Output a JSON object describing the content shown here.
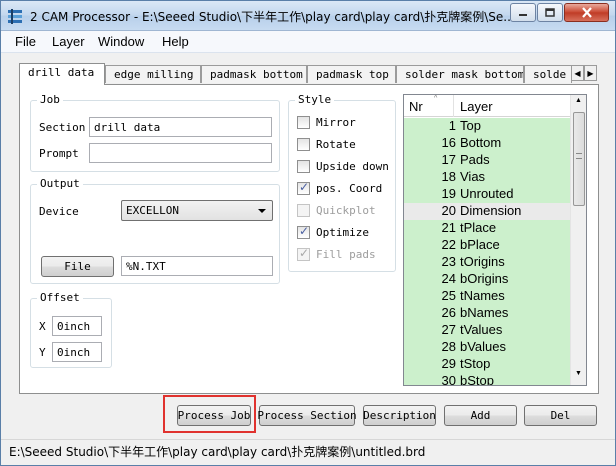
{
  "window": {
    "title": "2 CAM Processor - E:\\Seeed Studio\\下半年工作\\play card\\play card\\扑克牌案例\\Se...",
    "app_icon": "cam-processor-icon",
    "controls": [
      "minimize-icon",
      "maximize-icon",
      "close-icon"
    ]
  },
  "menu": [
    "File",
    "Layer",
    "Window",
    "Help"
  ],
  "tabs": [
    "drill data",
    "edge milling",
    "padmask bottom",
    "padmask top",
    "solder mask bottom",
    "solde"
  ],
  "job": {
    "group_title": "Job",
    "section_label": "Section",
    "section_value": "drill data",
    "prompt_label": "Prompt",
    "prompt_value": ""
  },
  "output": {
    "group_title": "Output",
    "device_label": "Device",
    "device_value": "EXCELLON",
    "file_button": "File",
    "file_value": "%N.TXT"
  },
  "offset": {
    "group_title": "Offset",
    "x_label": "X",
    "x_value": "0inch",
    "y_label": "Y",
    "y_value": "0inch"
  },
  "style": {
    "group_title": "Style",
    "options": [
      {
        "label": "Mirror",
        "checked": false,
        "disabled": false
      },
      {
        "label": "Rotate",
        "checked": false,
        "disabled": false
      },
      {
        "label": "Upside down",
        "checked": false,
        "disabled": false
      },
      {
        "label": "pos. Coord",
        "checked": true,
        "disabled": false
      },
      {
        "label": "Quickplot",
        "checked": false,
        "disabled": true
      },
      {
        "label": "Optimize",
        "checked": true,
        "disabled": false
      },
      {
        "label": "Fill pads",
        "checked": true,
        "disabled": true
      }
    ]
  },
  "layers": {
    "header_nr": "Nr",
    "header_layer": "Layer",
    "rows": [
      {
        "nr": "1",
        "name": "Top",
        "selected": true
      },
      {
        "nr": "16",
        "name": "Bottom",
        "selected": true
      },
      {
        "nr": "17",
        "name": "Pads",
        "selected": true
      },
      {
        "nr": "18",
        "name": "Vias",
        "selected": true
      },
      {
        "nr": "19",
        "name": "Unrouted",
        "selected": true
      },
      {
        "nr": "20",
        "name": "Dimension",
        "selected": false
      },
      {
        "nr": "21",
        "name": "tPlace",
        "selected": true
      },
      {
        "nr": "22",
        "name": "bPlace",
        "selected": true
      },
      {
        "nr": "23",
        "name": "tOrigins",
        "selected": true
      },
      {
        "nr": "24",
        "name": "bOrigins",
        "selected": true
      },
      {
        "nr": "25",
        "name": "tNames",
        "selected": true
      },
      {
        "nr": "26",
        "name": "bNames",
        "selected": true
      },
      {
        "nr": "27",
        "name": "tValues",
        "selected": true
      },
      {
        "nr": "28",
        "name": "bValues",
        "selected": true
      },
      {
        "nr": "29",
        "name": "tStop",
        "selected": true
      },
      {
        "nr": "30",
        "name": "bStop",
        "selected": true
      }
    ]
  },
  "actions": {
    "process_job": "Process Job",
    "process_section": "Process Section",
    "description": "Description",
    "add": "Add",
    "del": "Del"
  },
  "status": "E:\\Seeed Studio\\下半年工作\\play card\\play card\\扑克牌案例\\untitled.brd",
  "colors": {
    "selected_layer_bg": "#ccf0cc",
    "highlight_border": "#e0322e"
  }
}
